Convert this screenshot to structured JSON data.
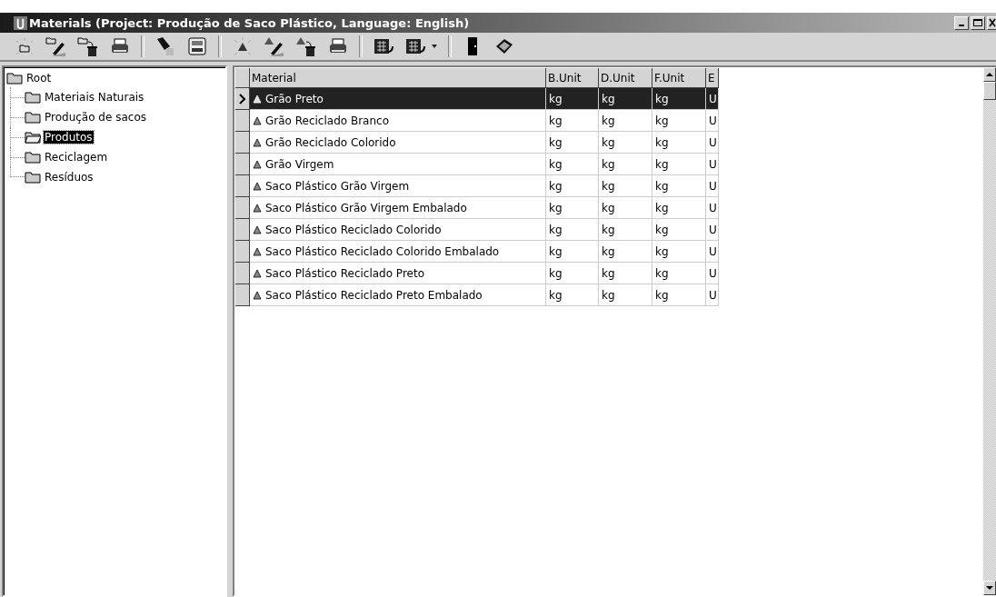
{
  "window": {
    "title": "Materials (Project: Produção de Saco Plástico, Language: English)"
  },
  "tree": {
    "label": "Root",
    "children": [
      {
        "label": "Materiais Naturais",
        "selected": false
      },
      {
        "label": "Produção de sacos",
        "selected": false
      },
      {
        "label": "Produtos",
        "selected": true
      },
      {
        "label": "Reciclagem",
        "selected": false
      },
      {
        "label": "Resíduos",
        "selected": false
      }
    ]
  },
  "table": {
    "columns": [
      "Material",
      "B.Unit",
      "D.Unit",
      "F.Unit",
      "E"
    ],
    "rows": [
      {
        "selected": true,
        "cells": [
          "Grão Preto",
          "kg",
          "kg",
          "kg",
          "U"
        ]
      },
      {
        "selected": false,
        "cells": [
          "Grão Reciclado Branco",
          "kg",
          "kg",
          "kg",
          "U"
        ]
      },
      {
        "selected": false,
        "cells": [
          "Grão Reciclado Colorido",
          "kg",
          "kg",
          "kg",
          "U"
        ]
      },
      {
        "selected": false,
        "cells": [
          "Grão Virgem",
          "kg",
          "kg",
          "kg",
          "U"
        ]
      },
      {
        "selected": false,
        "cells": [
          "Saco Plástico Grão Virgem",
          "kg",
          "kg",
          "kg",
          "U"
        ]
      },
      {
        "selected": false,
        "cells": [
          "Saco Plástico Grão Virgem Embalado",
          "kg",
          "kg",
          "kg",
          "U"
        ]
      },
      {
        "selected": false,
        "cells": [
          "Saco Plástico Reciclado Colorido",
          "kg",
          "kg",
          "kg",
          "U"
        ]
      },
      {
        "selected": false,
        "cells": [
          "Saco Plástico Reciclado Colorido Embalado",
          "kg",
          "kg",
          "kg",
          "U"
        ]
      },
      {
        "selected": false,
        "cells": [
          "Saco Plástico Reciclado Preto",
          "kg",
          "kg",
          "kg",
          "U"
        ]
      },
      {
        "selected": false,
        "cells": [
          "Saco Plástico Reciclado Preto Embalado",
          "kg",
          "kg",
          "kg",
          "U"
        ]
      }
    ]
  }
}
